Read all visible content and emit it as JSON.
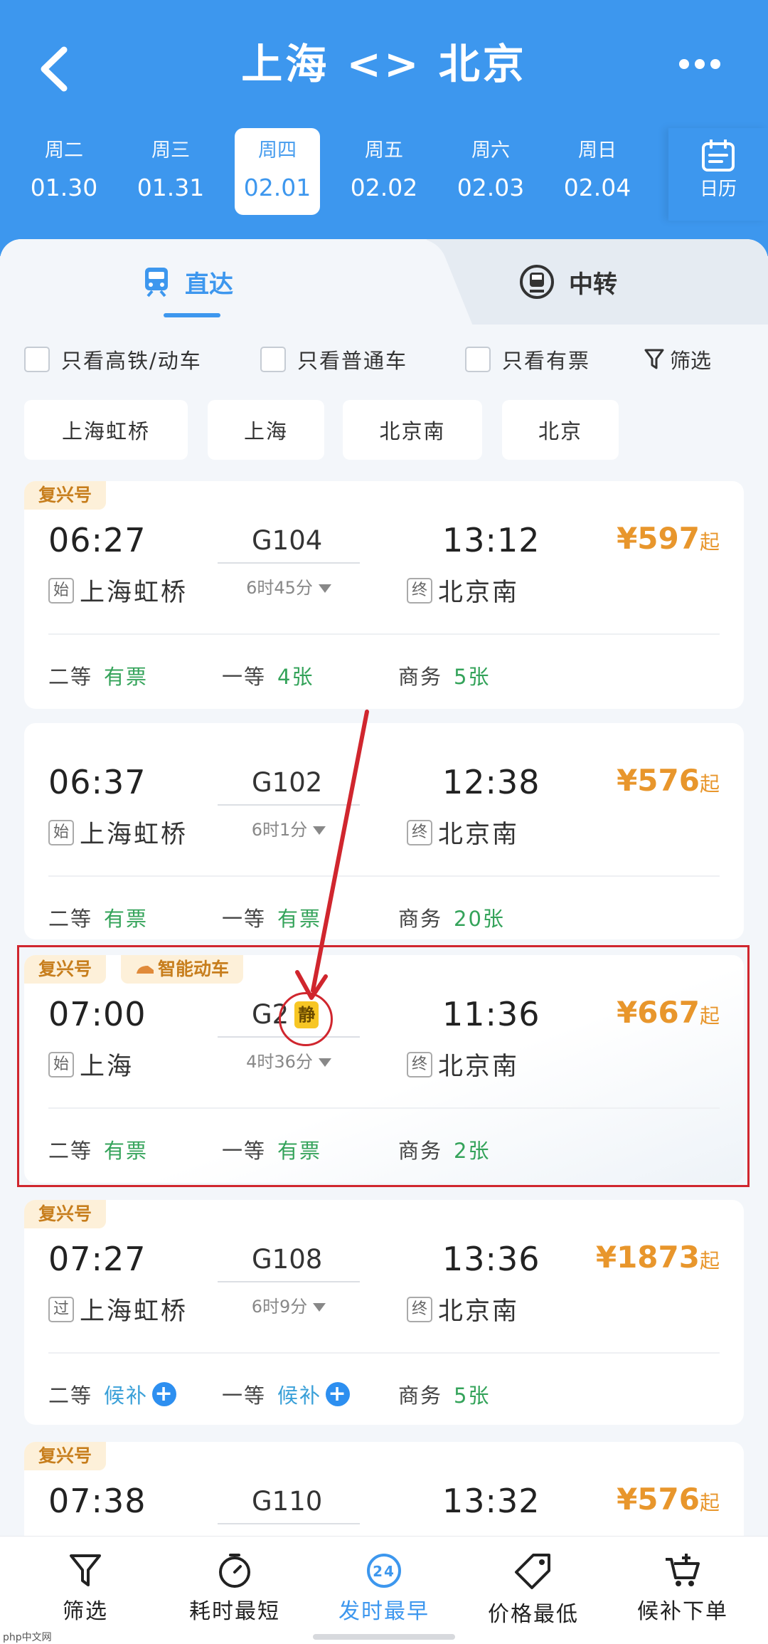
{
  "header": {
    "title": "上海 <> 北京",
    "dates": [
      {
        "weekday": "周二",
        "date": "01.30"
      },
      {
        "weekday": "周三",
        "date": "01.31"
      },
      {
        "weekday": "周四",
        "date": "02.01",
        "active": true
      },
      {
        "weekday": "周五",
        "date": "02.02"
      },
      {
        "weekday": "周六",
        "date": "02.03"
      },
      {
        "weekday": "周日",
        "date": "02.04"
      }
    ],
    "calendar_label": "日历"
  },
  "tabs": {
    "direct": "直达",
    "transfer": "中转"
  },
  "filters": {
    "only_high_speed": "只看高铁/动车",
    "only_normal": "只看普通车",
    "only_available": "只看有票",
    "filter": "筛选"
  },
  "station_chips": [
    "上海虹桥",
    "上海",
    "北京南",
    "北京"
  ],
  "trains": [
    {
      "tag": "复兴号",
      "dep_time": "06:27",
      "train_no": "G104",
      "arr_time": "13:12",
      "price": "¥597",
      "price_suffix": "起",
      "duration": "6时45分",
      "from_badge": "始",
      "from_station": "上海虹桥",
      "to_badge": "终",
      "to_station": "北京南",
      "seats": [
        {
          "class": "二等",
          "value": "有票"
        },
        {
          "class": "一等",
          "value": "4张"
        },
        {
          "class": "商务",
          "value": "5张"
        }
      ]
    },
    {
      "tag": "",
      "dep_time": "06:37",
      "train_no": "G102",
      "arr_time": "12:38",
      "price": "¥576",
      "price_suffix": "起",
      "duration": "6时1分",
      "from_badge": "始",
      "from_station": "上海虹桥",
      "to_badge": "终",
      "to_station": "北京南",
      "seats": [
        {
          "class": "二等",
          "value": "有票"
        },
        {
          "class": "一等",
          "value": "有票"
        },
        {
          "class": "商务",
          "value": "20张"
        }
      ]
    },
    {
      "tag": "复兴号",
      "tag2": "智能动车",
      "dep_time": "07:00",
      "train_no": "G2",
      "quiet_badge": "静",
      "arr_time": "11:36",
      "price": "¥667",
      "price_suffix": "起",
      "duration": "4时36分",
      "from_badge": "始",
      "from_station": "上海",
      "to_badge": "终",
      "to_station": "北京南",
      "seats": [
        {
          "class": "二等",
          "value": "有票"
        },
        {
          "class": "一等",
          "value": "有票"
        },
        {
          "class": "商务",
          "value": "2张"
        }
      ]
    },
    {
      "tag": "复兴号",
      "dep_time": "07:27",
      "train_no": "G108",
      "arr_time": "13:36",
      "price": "¥1873",
      "price_suffix": "起",
      "duration": "6时9分",
      "from_badge": "过",
      "from_station": "上海虹桥",
      "to_badge": "终",
      "to_station": "北京南",
      "seats": [
        {
          "class": "二等",
          "value": "候补"
        },
        {
          "class": "一等",
          "value": "候补"
        },
        {
          "class": "商务",
          "value": "5张"
        }
      ]
    },
    {
      "tag": "复兴号",
      "dep_time": "07:38",
      "train_no": "G110",
      "arr_time": "13:32",
      "price": "¥576",
      "price_suffix": "起"
    }
  ],
  "bottom_bar": {
    "filter": "筛选",
    "shortest": "耗时最短",
    "earliest": "发时最早",
    "earliest_icon_text": "24",
    "cheapest": "价格最低",
    "waitlist": "候补下单"
  },
  "watermark": "php中文网",
  "colors": {
    "primary": "#3d97ee",
    "price": "#e8962c",
    "available": "#34a35a",
    "annotation": "#d0262e"
  }
}
